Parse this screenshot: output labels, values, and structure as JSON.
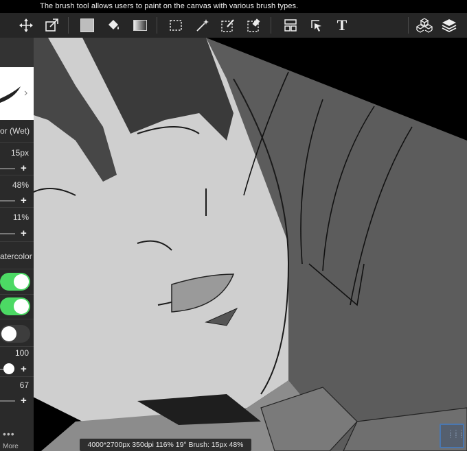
{
  "tooltip": "The brush tool allows users to paint on the canvas with various brush types.",
  "toolbar": {
    "tools": [
      "move-icon",
      "transform-icon",
      "fill-color-swatch",
      "paint-bucket-icon",
      "gradient-icon",
      "rectangle-select-icon",
      "magic-wand-icon",
      "select-pen-icon",
      "select-eraser-icon",
      "layout-icon",
      "select-layer-icon",
      "text-icon",
      "3d-material-icon",
      "layers-icon"
    ],
    "text_tool_label": "T"
  },
  "brush_panel": {
    "brush_name": "or (Wet)",
    "size": "15px",
    "opacity": "48%",
    "density": "11%",
    "mode": "atercolor",
    "value_a": "100",
    "value_b": "67",
    "toggle_1": true,
    "toggle_2": true,
    "toggle_3": false,
    "more_label": "More",
    "more_dots": "•••",
    "plus": "+",
    "next_arrow": "›"
  },
  "status": "4000*2700px 350dpi 116% 19° Brush: 15px 48%",
  "colors": {
    "toolbar_bg": "#262626",
    "panel_bg": "#2a2a2a",
    "toggle_on": "#4cd964",
    "accent_blue": "#4a77b0"
  }
}
